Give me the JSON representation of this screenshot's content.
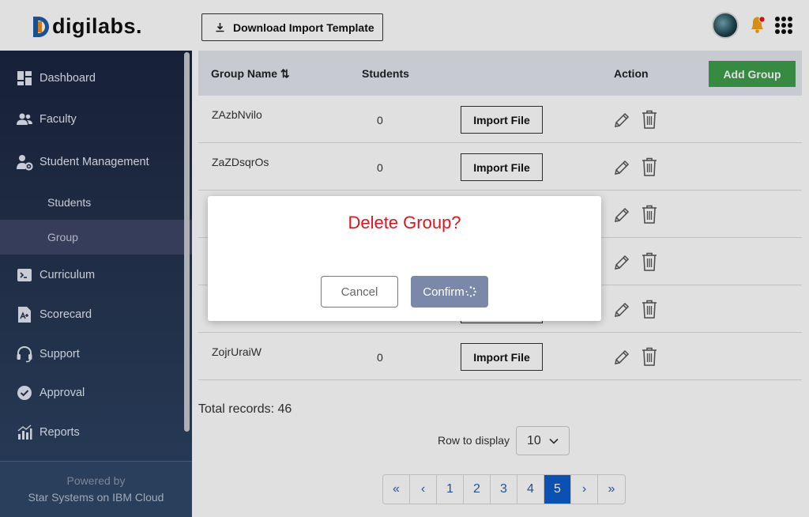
{
  "header": {
    "logo_text": "digilabs.",
    "download_label": "Download Import Template"
  },
  "sidebar": {
    "items": [
      {
        "label": "Dashboard",
        "icon": "dashboard-icon"
      },
      {
        "label": "Faculty",
        "icon": "users-icon"
      },
      {
        "label": "Student Management",
        "icon": "user-gear-icon"
      },
      {
        "label": "Students"
      },
      {
        "label": "Group"
      },
      {
        "label": "Curriculum",
        "icon": "terminal-icon"
      },
      {
        "label": "Scorecard",
        "icon": "scorecard-icon"
      },
      {
        "label": "Support",
        "icon": "headset-icon"
      },
      {
        "label": "Approval",
        "icon": "check-circle-icon"
      },
      {
        "label": "Reports",
        "icon": "bar-chart-icon"
      }
    ],
    "active_item": "Group",
    "powered_by": "Powered by",
    "powered_company": "Star Systems on IBM Cloud"
  },
  "table": {
    "columns": [
      "Group Name ⇅",
      "Students",
      "Action"
    ],
    "add_group_label": "Add Group",
    "import_label": "Import File",
    "rows": [
      {
        "name": "ZAzbNvilo",
        "students": "0"
      },
      {
        "name": "ZaZDsqrOs",
        "students": "0"
      },
      {
        "name": "",
        "students": ""
      },
      {
        "name": "",
        "students": ""
      },
      {
        "name": "",
        "students": ""
      },
      {
        "name": "ZojrUraiW",
        "students": "0"
      }
    ]
  },
  "footer": {
    "total_records": "Total records: 46",
    "rows_label": "Row to display",
    "rows_value": "10"
  },
  "pagination": {
    "first": "«",
    "prev": "‹",
    "pages": [
      "1",
      "2",
      "3",
      "4",
      "5"
    ],
    "current": "5",
    "next": "›",
    "last": "»"
  },
  "modal": {
    "title": "Delete Group?",
    "cancel_label": "Cancel",
    "confirm_label": "Confirm"
  },
  "colors": {
    "sidebar_top": "#1a2540",
    "sidebar_bottom": "#2e4565",
    "add_group": "#3f9e4a",
    "modal_title": "#e0141e",
    "confirm_btn": "#7c88aa",
    "page_active": "#0d5ccc"
  }
}
